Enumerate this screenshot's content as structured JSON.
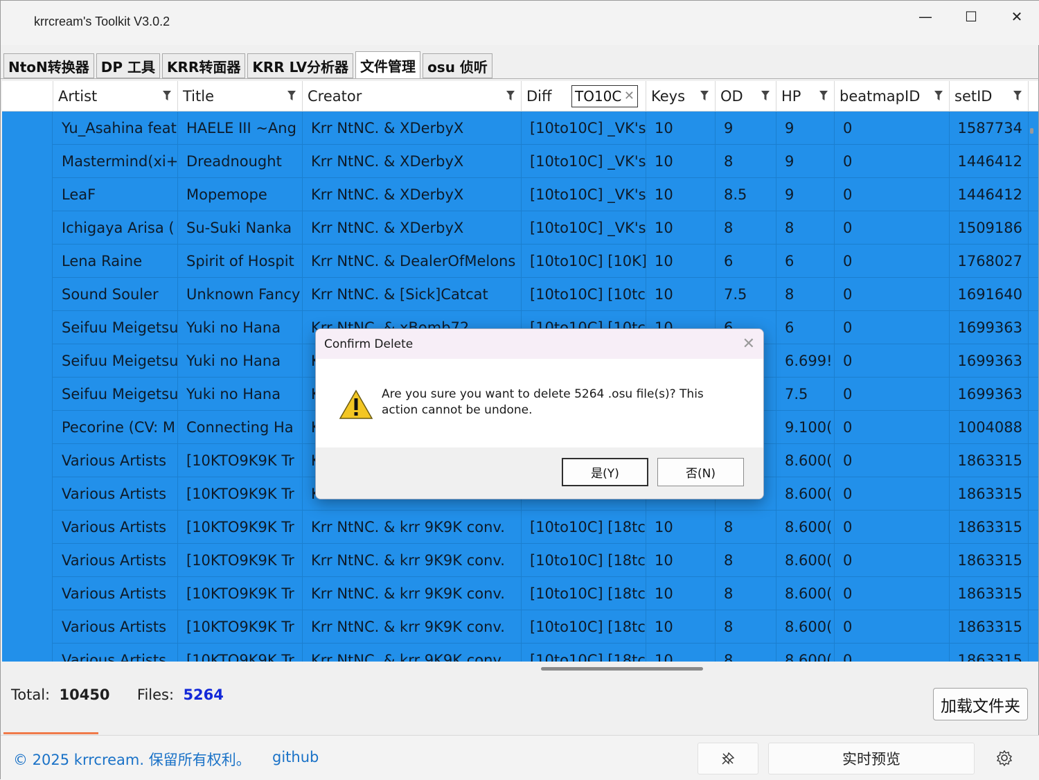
{
  "window": {
    "title": "krrcream's Toolkit V3.0.2",
    "controls": {
      "minimize": "—",
      "maximize": "☐",
      "close": "✕"
    }
  },
  "tabs": [
    "NtoN转换器",
    "DP 工具",
    "KRR转面器",
    "KRR LV分析器",
    "文件管理",
    "osu 侦听"
  ],
  "active_tab": "文件管理",
  "grid": {
    "columns": [
      "Artist",
      "Title",
      "Creator",
      "Diff",
      "Keys",
      "OD",
      "HP",
      "beatmapID",
      "setID"
    ],
    "diff_filter_value": "TO10C",
    "rows": [
      [
        "Yu_Asahina feat",
        "HAELE III ~Ang",
        "Krr NtNC. & XDerbyX",
        "[10to10C] _VK's",
        "10",
        "9",
        "9",
        "0",
        "1587734"
      ],
      [
        "Mastermind(xi+",
        "Dreadnought",
        "Krr NtNC. & XDerbyX",
        "[10to10C] _VK's",
        "10",
        "8",
        "9",
        "0",
        "1446412"
      ],
      [
        "LeaF",
        "Mopemope",
        "Krr NtNC. & XDerbyX",
        "[10to10C] _VK's",
        "10",
        "8.5",
        "9",
        "0",
        "1446412"
      ],
      [
        "Ichigaya Arisa (",
        "Su-Suki Nanka",
        "Krr NtNC. & XDerbyX",
        "[10to10C] _VK's",
        "10",
        "8",
        "8",
        "0",
        "1509186"
      ],
      [
        "Lena Raine",
        "Spirit of Hospit",
        "Krr NtNC. & DealerOfMelons",
        "[10to10C] [10K]",
        "10",
        "6",
        "6",
        "0",
        "1768027"
      ],
      [
        "Sound Souler",
        "Unknown Fancy",
        "Krr NtNC. & [Sick]Catcat",
        "[10to10C] [10tc",
        "10",
        "7.5",
        "8",
        "0",
        "1691640"
      ],
      [
        "Seifuu Meigetsu",
        "Yuki no Hana",
        "Krr NtNC. & xBomb72",
        "[10to10C] [10tc",
        "10",
        "6",
        "6",
        "0",
        "1699363"
      ],
      [
        "Seifuu Meigetsu",
        "Yuki no Hana",
        "K",
        "",
        "",
        "",
        "6.699!",
        "0",
        "1699363"
      ],
      [
        "Seifuu Meigetsu",
        "Yuki no Hana",
        "K",
        "",
        "",
        "",
        "7.5",
        "0",
        "1699363"
      ],
      [
        "Pecorine (CV: M",
        "Connecting Ha",
        "K",
        "",
        "",
        "",
        "9.100(",
        "0",
        "1004088"
      ],
      [
        "Various Artists",
        "[10KTO9K9K Tr",
        "K",
        "",
        "",
        "",
        "8.600(",
        "0",
        "1863315"
      ],
      [
        "Various Artists",
        "[10KTO9K9K Tr",
        "K",
        "",
        "",
        "",
        "8.600(",
        "0",
        "1863315"
      ],
      [
        "Various Artists",
        "[10KTO9K9K Tr",
        "Krr NtNC. & krr 9K9K conv.",
        "[10to10C] [18tc",
        "10",
        "8",
        "8.600(",
        "0",
        "1863315"
      ],
      [
        "Various Artists",
        "[10KTO9K9K Tr",
        "Krr NtNC. & krr 9K9K conv.",
        "[10to10C] [18tc",
        "10",
        "8",
        "8.600(",
        "0",
        "1863315"
      ],
      [
        "Various Artists",
        "[10KTO9K9K Tr",
        "Krr NtNC. & krr 9K9K conv.",
        "[10to10C] [18tc",
        "10",
        "8",
        "8.600(",
        "0",
        "1863315"
      ],
      [
        "Various Artists",
        "[10KTO9K9K Tr",
        "Krr NtNC. & krr 9K9K conv.",
        "[10to10C] [18tc",
        "10",
        "8",
        "8.600(",
        "0",
        "1863315"
      ],
      [
        "Various Artists",
        "[10KTO9K9K Tr",
        "Krr NtNC. & krr 9K9K conv.",
        "[10to10C] [18tc",
        "10",
        "8",
        "8.600(",
        "0",
        "1863315"
      ]
    ]
  },
  "status": {
    "total_label": "Total:",
    "total_value": "10450",
    "files_label": "Files:",
    "files_value": "5264"
  },
  "buttons": {
    "load_folder": "加载文件夹",
    "realtime_preview": "实时预览"
  },
  "footer": {
    "copyright": "© 2025 krrcream. 保留所有权利。",
    "github": "github"
  },
  "dialog": {
    "title": "Confirm Delete",
    "message": "Are you sure you want to delete 5264 .osu file(s)? This action cannot be undone.",
    "yes": "是(Y)",
    "no": "否(N)"
  },
  "colors": {
    "selection": "#2290ea",
    "files_count": "#1328d8",
    "link": "#1a72c7",
    "accent_bar": "#f07a4a"
  },
  "icons": [
    "filter-icon",
    "clear-filter-icon",
    "warning-icon",
    "pin-icon",
    "gear-icon",
    "close-icon"
  ]
}
